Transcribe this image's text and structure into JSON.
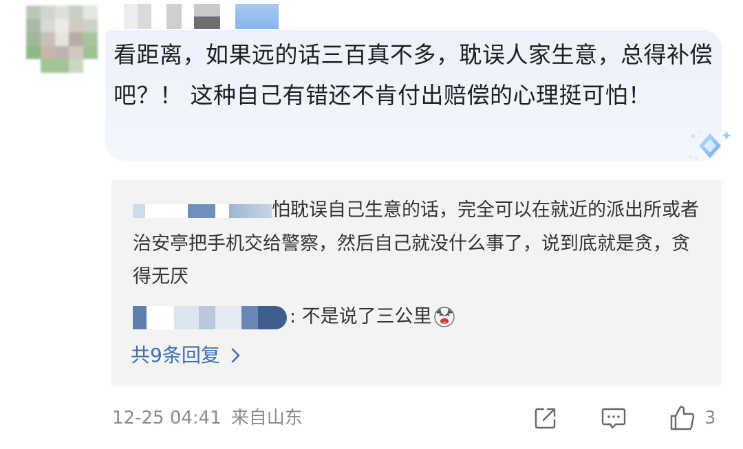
{
  "comment": {
    "text": "看距离，如果远的话三百真不多，耽误人家生意，总得补偿吧？！ 这种自己有错还不肯付出赔偿的心理挺可怕！",
    "timestamp": "12-25 04:41",
    "location": "来自山东",
    "like_count": "3"
  },
  "replies": [
    {
      "text": "怕耽误自己生意的话，完全可以在就近的派出所或者治安亭把手机交给警察，然后自己就没什么事了，说到底就是贪，贪得无厌"
    },
    {
      "text": "不是说了三公里"
    }
  ],
  "more_replies_label": "共9条回复",
  "icons": {
    "avatar": "avatar",
    "diamond": "diamond-badge-icon",
    "emoji": "laughing-dog-emoji-icon",
    "chevron": "chevron-right-icon",
    "share": "share-icon",
    "comment": "comment-icon",
    "like": "thumbs-up-icon"
  },
  "colors": {
    "bubble": "#ecf1fb",
    "reply_box": "#f3f3f3",
    "link": "#3d6fb2",
    "meta": "#8a8a8a"
  }
}
